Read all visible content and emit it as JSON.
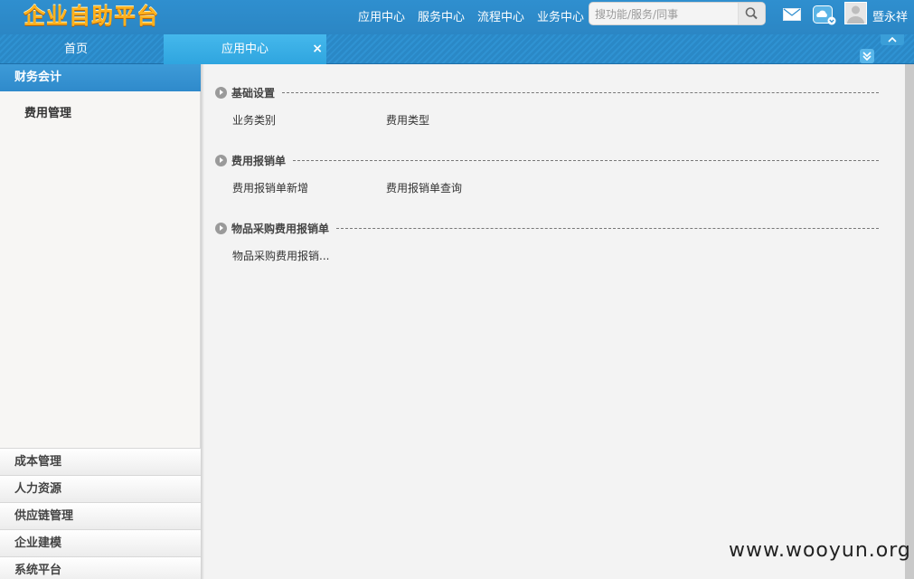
{
  "header": {
    "logo": "企业自助平台",
    "nav": [
      "应用中心",
      "服务中心",
      "流程中心",
      "业务中心"
    ],
    "search_placeholder": "搜功能/服务/同事",
    "username": "暨永祥"
  },
  "tabs": {
    "home": "首页",
    "active": "应用中心",
    "close": "×"
  },
  "sidebar": {
    "header": "财务会计",
    "sub_item": "费用管理",
    "groups": [
      "成本管理",
      "人力资源",
      "供应链管理",
      "企业建模",
      "系统平台"
    ]
  },
  "main": {
    "sections": [
      {
        "title": "基础设置",
        "links": [
          "业务类别",
          "费用类型"
        ]
      },
      {
        "title": "费用报销单",
        "links": [
          "费用报销单新增",
          "费用报销单查询"
        ]
      },
      {
        "title": "物品采购费用报销单",
        "links": [
          "物品采购费用报销..."
        ]
      }
    ]
  },
  "watermark": "www.wooyun.org",
  "colors": {
    "primary": "#2f8fcf",
    "logo": "#ffb21c"
  }
}
